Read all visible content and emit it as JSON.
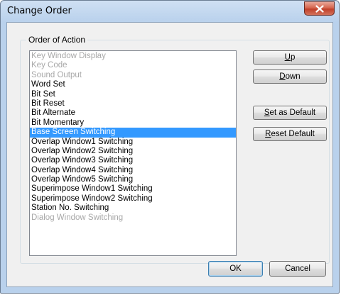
{
  "window": {
    "title": "Change Order",
    "close_glyph": "x"
  },
  "group": {
    "label": "Order of Action"
  },
  "list": {
    "items": [
      {
        "label": "Key Window Display",
        "state": "disabled"
      },
      {
        "label": "Key Code",
        "state": "disabled"
      },
      {
        "label": "Sound Output",
        "state": "disabled"
      },
      {
        "label": "Word Set",
        "state": "normal"
      },
      {
        "label": "Bit Set",
        "state": "normal"
      },
      {
        "label": "Bit Reset",
        "state": "normal"
      },
      {
        "label": "Bit Alternate",
        "state": "normal"
      },
      {
        "label": "Bit Momentary",
        "state": "normal"
      },
      {
        "label": "Base Screen Switching",
        "state": "selected"
      },
      {
        "label": "Overlap Window1 Switching",
        "state": "normal"
      },
      {
        "label": "Overlap Window2 Switching",
        "state": "normal"
      },
      {
        "label": "Overlap Window3 Switching",
        "state": "normal"
      },
      {
        "label": "Overlap Window4 Switching",
        "state": "normal"
      },
      {
        "label": "Overlap Window5 Switching",
        "state": "normal"
      },
      {
        "label": "Superimpose Window1 Switching",
        "state": "normal"
      },
      {
        "label": "Superimpose Window2 Switching",
        "state": "normal"
      },
      {
        "label": "Station No. Switching",
        "state": "normal"
      },
      {
        "label": "Dialog Window Switching",
        "state": "disabled"
      }
    ]
  },
  "buttons": {
    "up": {
      "mnemonic": "U",
      "rest": "p"
    },
    "down": {
      "mnemonic": "D",
      "rest": "own"
    },
    "set_default": {
      "mnemonic": "S",
      "rest": "et as Default"
    },
    "reset_default": {
      "mnemonic": "R",
      "rest": "eset Default"
    },
    "ok": {
      "label": "OK"
    },
    "cancel": {
      "label": "Cancel"
    }
  },
  "colors": {
    "selection": "#3399ff",
    "disabled_text": "#a8a8a8",
    "title_bar": "#b9d1ec",
    "close_button": "#c1412b"
  }
}
